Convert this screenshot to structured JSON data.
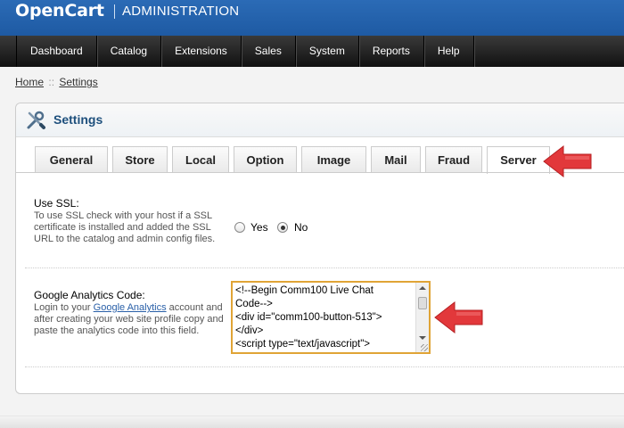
{
  "header": {
    "logo": "OpenCart",
    "section": "ADMINISTRATION"
  },
  "menu": {
    "items": [
      "Dashboard",
      "Catalog",
      "Extensions",
      "Sales",
      "System",
      "Reports",
      "Help"
    ]
  },
  "breadcrumb": {
    "home": "Home",
    "separator": "::",
    "current": "Settings"
  },
  "box": {
    "title": "Settings",
    "icon": "wrench-screwdriver-icon"
  },
  "tabs": [
    "General",
    "Store",
    "Local",
    "Option",
    "Image",
    "Mail",
    "Fraud",
    "Server"
  ],
  "active_tab": "Server",
  "ssl": {
    "label": "Use SSL:",
    "help": "To use SSL check with your host if a SSL certificate is installed and added the SSL URL to the catalog and admin config files.",
    "options": [
      "Yes",
      "No"
    ],
    "selected": "No"
  },
  "analytics": {
    "label": "Google Analytics Code:",
    "help_before": "Login to your ",
    "help_link": "Google Analytics",
    "help_after": " account and after creating your web site profile copy and paste the analytics code into this field.",
    "value": "<!--Begin Comm100 Live Chat\nCode-->\n<div id=\"comm100-button-513\">\n</div>\n<script type=\"text/javascript\">"
  },
  "colors": {
    "header": "#1e5aa3",
    "arrow": "#e2383b",
    "title": "#1d4f7c",
    "textarea_border": "#e0a436"
  }
}
